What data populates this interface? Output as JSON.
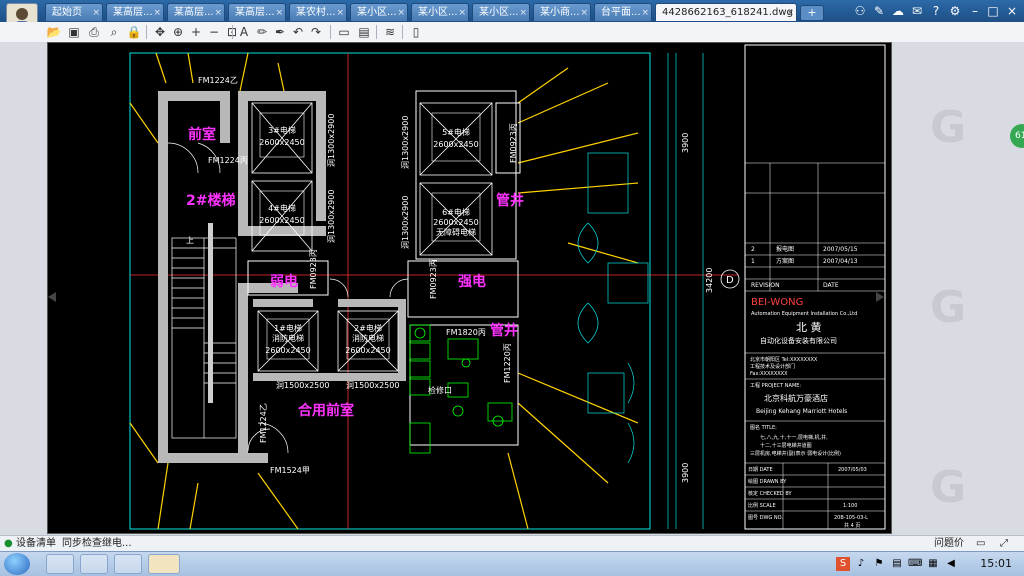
{
  "tabs": [
    {
      "label": "起始页"
    },
    {
      "label": "某高层..."
    },
    {
      "label": "某高层..."
    },
    {
      "label": "某高层..."
    },
    {
      "label": "某农村..."
    },
    {
      "label": "某小区..."
    },
    {
      "label": "某小区..."
    },
    {
      "label": "某小区..."
    },
    {
      "label": "某小商..."
    },
    {
      "label": "台平面..."
    },
    {
      "label": "4428662163_618241.dwg"
    }
  ],
  "new_tab_label": "+",
  "close_glyph": "×",
  "drawing": {
    "rooms": {
      "front_room": "前室",
      "stair": "2#楼梯",
      "weak_elec": "弱电",
      "strong_elec": "强电",
      "pipe_shaft_1": "管井",
      "pipe_shaft_2": "管井",
      "shared_front_room": "合用前室"
    },
    "doors": {
      "fm1224_top": "FM1224乙",
      "fm1224_mid": "FM1224丙",
      "fm0923_left": "FM0923丙",
      "fm0923_right": "FM0923丙",
      "fm0923_pipe": "FM0923丙",
      "fm1820": "FM1820丙",
      "fm1224_lower": "FM1224乙",
      "fm1524": "FM1524甲",
      "fm1220": "FM1220丙",
      "access": "检修口"
    },
    "elevators": {
      "e3_name": "3#电梯",
      "e3_size": "2600x2450",
      "e4_name": "4#电梯",
      "e4_size": "2600x2450",
      "e5_name": "5#电梯",
      "e5_size": "2600x2450",
      "e6_name": "6#电梯",
      "e6_size": "2600x2450",
      "e6_note": "无障碍电梯",
      "e1_name": "1#电梯",
      "e1_note": "消防电梯",
      "e1_size": "2600x2450",
      "e2_name": "2#电梯",
      "e2_note": "消防电梯",
      "e2_size": "2600x2450"
    },
    "openings": {
      "o1": "洞1300x2900",
      "o2": "洞1300x2900",
      "o3": "洞1300x2900",
      "o4": "洞1300x2900",
      "o5": "洞1500x2500",
      "o6": "洞1500x2500"
    },
    "dims": {
      "d1": "3900",
      "d2": "3900",
      "d3": "34200"
    },
    "axis_label": "D",
    "stair_up": "上"
  },
  "title_block": {
    "rev1": "2",
    "rev1_desc": "报电图",
    "rev1_date": "2007/05/15",
    "rev2": "1",
    "rev2_desc": "方案图",
    "rev2_date": "2007/04/13",
    "revision_label": "REVISION",
    "date_label": "DATE",
    "company_brand": "BEI-WONG",
    "company_en": "Automation Equipment Installation Co.,Ltd",
    "company_cn_1": "北 黄",
    "company_cn_2": "自动化设备安装有限公司",
    "info_line1": "北京市朝阳区 Tel:XXXXXXXX",
    "info_line2": "工程技术及设计部门",
    "info_line3": "Fax:XXXXXXXX",
    "project_label": "工程 PROJECT NAME:",
    "project_cn": "北京科航万豪酒店",
    "project_en": "Beijing Kehang Marriott Hotels",
    "title_label": "图名 TITLE:",
    "title_line1": "七,八,九,十,十一,层电梯,机,井,",
    "title_line2": "十二,十三层电梯井道图",
    "title_line3": "三层机房,电梯井(副)表示 弱电设计(比例)",
    "date_row_label": "日期 DATE",
    "date_row_value": "2007/05/03",
    "drawn_label": "绘图 DRAWN BY",
    "checked_label": "核定 CHECKED BY",
    "scale_label": "比例 SCALE",
    "scale_value": "1:100",
    "dwg_label": "图号 DWG NO.",
    "dwg_value": "20B-105-03-L",
    "sheet_value": "共 4 页"
  },
  "right_badge": "61",
  "status": {
    "item1": "设备清单",
    "item2": "同步检查继电...",
    "right_label": "问题价"
  },
  "clock": "15:01"
}
